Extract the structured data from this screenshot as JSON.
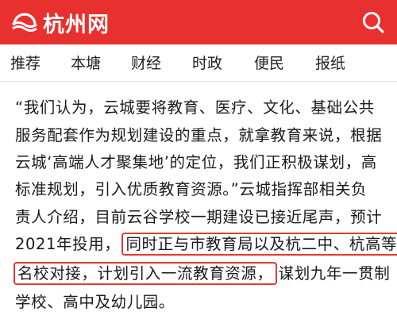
{
  "header": {
    "site_name": "杭州网",
    "logo_icon": "sun-wave-logo-icon",
    "search_icon": "search-icon",
    "bg_color": "#e8302e"
  },
  "nav": {
    "items": [
      "推荐",
      "本塘",
      "财经",
      "时政",
      "便民",
      "报纸"
    ]
  },
  "article": {
    "lines": [
      "“我们认为，云城要将教育、医疗、文化、基础公共",
      "服务配套作为规划建设的重点，就拿教育来说，根据",
      "云城‘高端人才聚集地’的定位，我们正积极谋划，高",
      "标准规划，引入优质教育资源。”云城指挥部相关负",
      "责人介绍，目前云谷学校一期建设已接近尾声，预计"
    ],
    "line6_prefix": "2021年投用，",
    "highlight_1": "同时正与市教育局以及杭二中、杭高等",
    "highlight_2": "名校对接，计划引入一流教育资源，",
    "line7_suffix": "谋划九年一贯制",
    "line8": "学校、高中及幼儿园。",
    "highlight_color": "#e53935"
  }
}
